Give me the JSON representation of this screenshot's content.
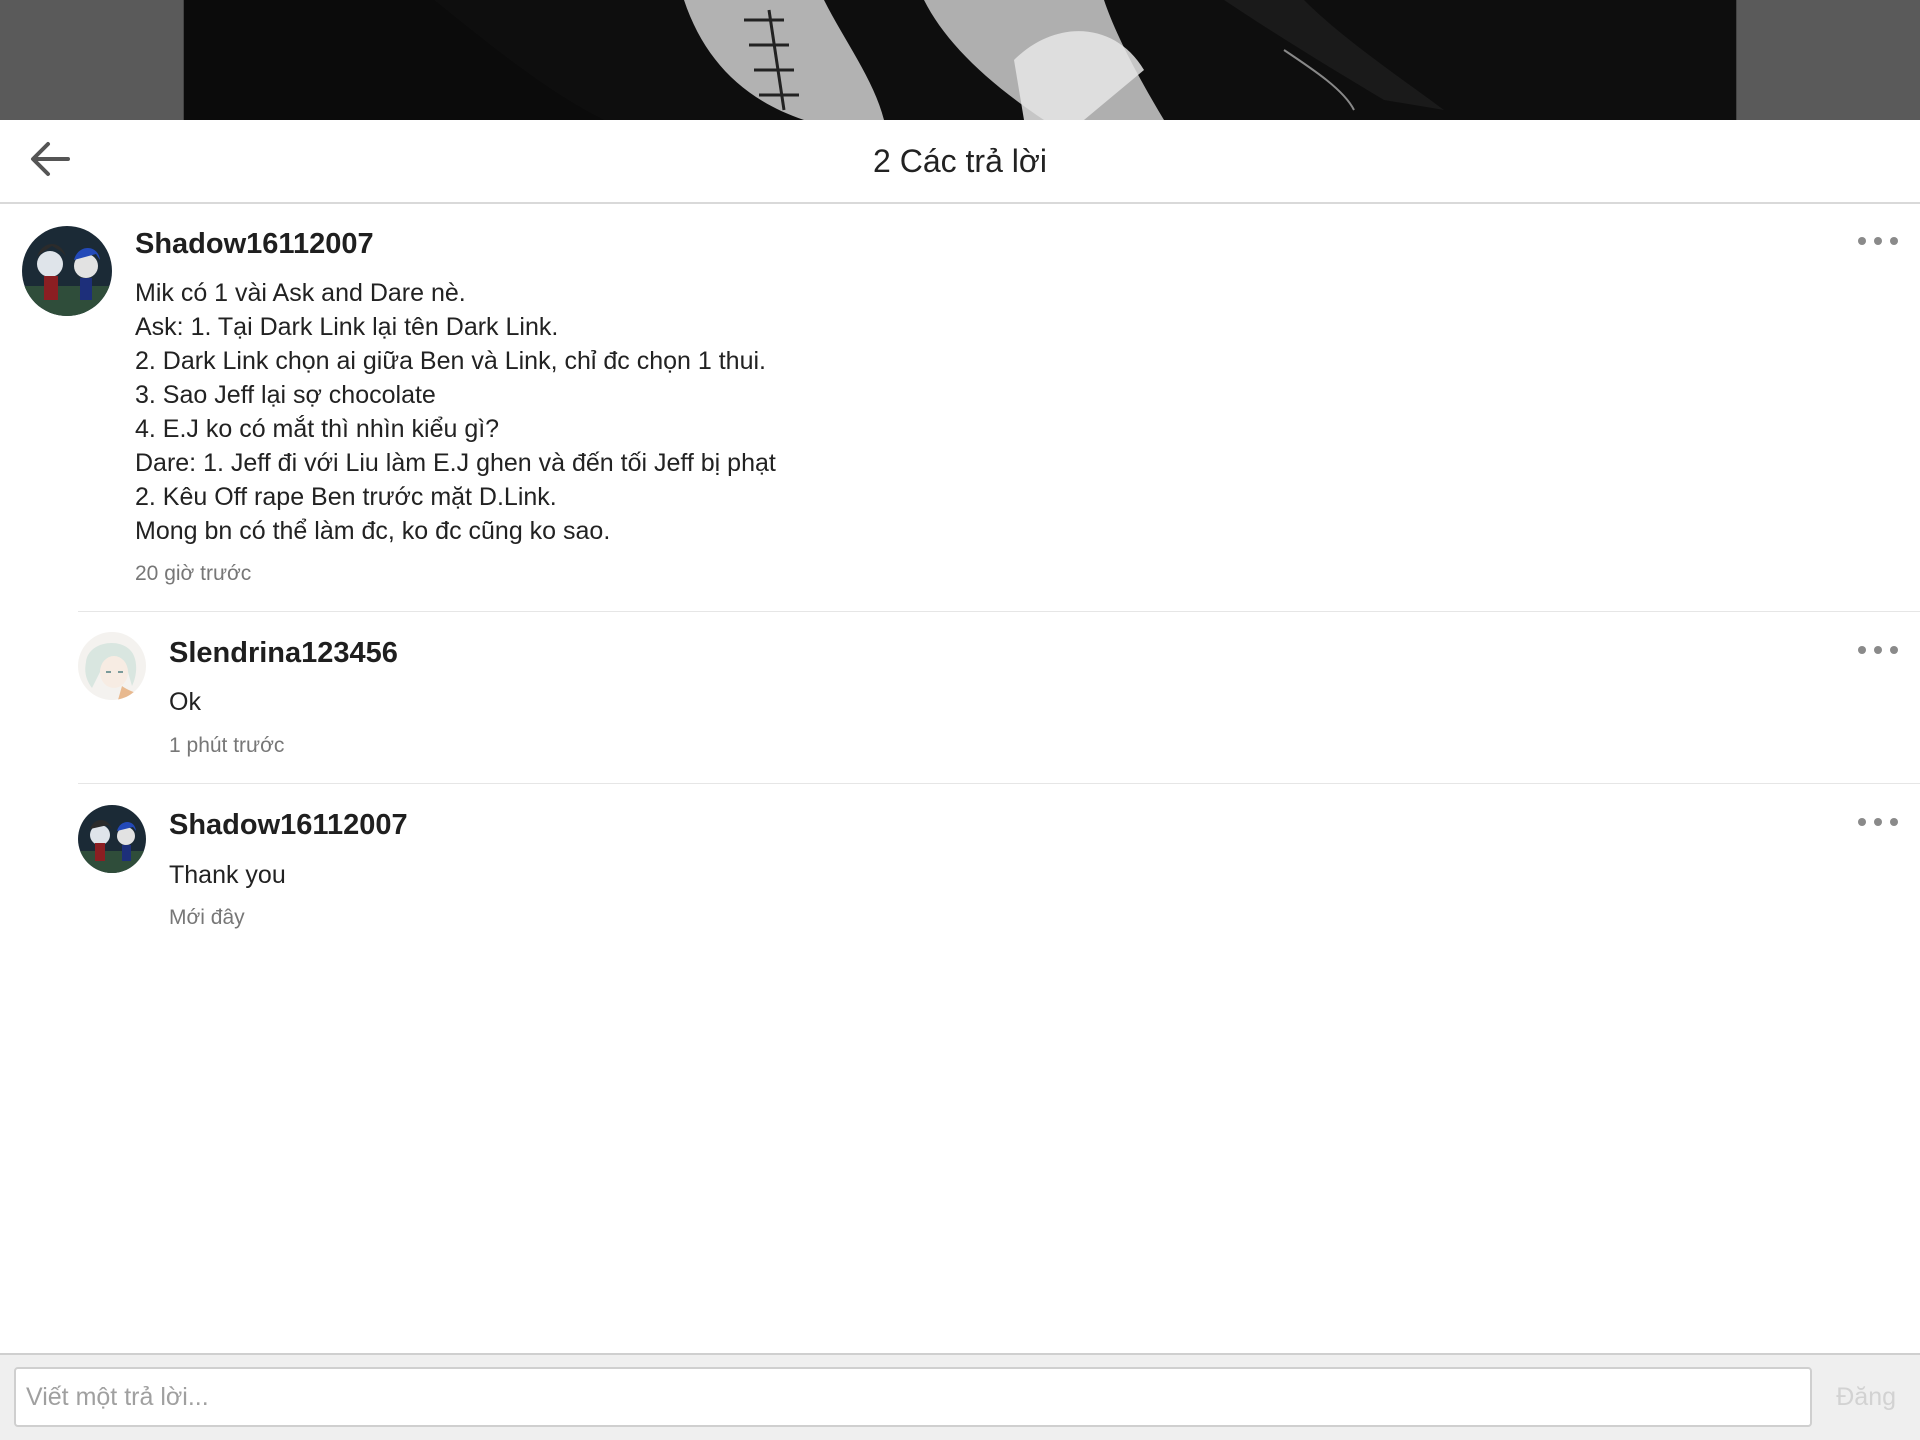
{
  "header": {
    "title": "2 Các trả lời",
    "back_icon": "arrow-left-icon"
  },
  "comments": [
    {
      "author": "Shadow16112007",
      "lines": [
        "Mik có 1 vài Ask and Dare nè.",
        "Ask: 1. Tại Dark Link lại tên Dark Link.",
        "2. Dark Link chọn ai giữa Ben và Link, chỉ đc chọn 1 thui.",
        "3. Sao Jeff lại sợ chocolate",
        "4. E.J ko có mắt thì nhìn kiểu gì?",
        "Dare: 1. Jeff đi với Liu làm E.J ghen và đến tối Jeff bị phạt",
        "2. Kêu Off rape Ben trước mặt D.Link.",
        "Mong bn có thể làm đc, ko đc cũng ko sao."
      ],
      "time": "20 giờ trước"
    },
    {
      "author": "Slendrina123456",
      "lines": [
        "Ok"
      ],
      "time": "1 phút trước"
    },
    {
      "author": "Shadow16112007",
      "lines": [
        "Thank you"
      ],
      "time": "Mới đây"
    }
  ],
  "composer": {
    "placeholder": "Viết một trả lời...",
    "post_label": "Đăng"
  },
  "colors": {
    "timestamp": "#777777",
    "post_disabled": "#d2d2d2",
    "divider": "#e6e6e6"
  }
}
